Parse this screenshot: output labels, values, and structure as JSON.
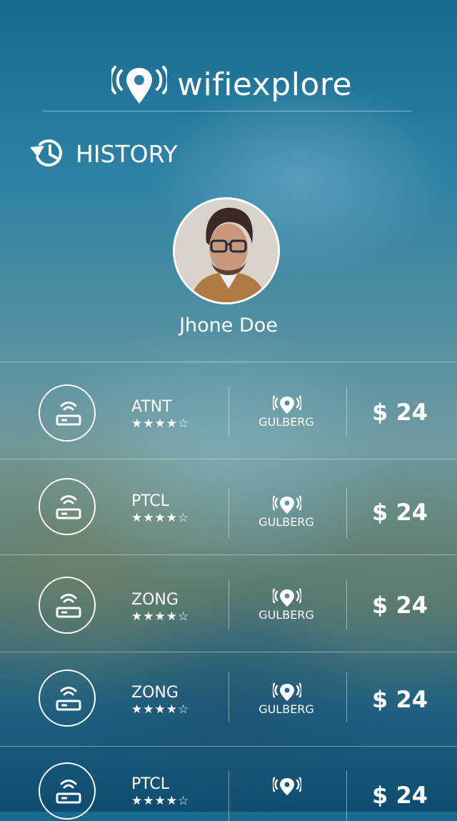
{
  "app": {
    "title": "wifiexplore",
    "logo_icon": "wifi-location-icon"
  },
  "section": {
    "title": "HISTORY",
    "icon": "history-icon"
  },
  "profile": {
    "name": "Jhone Doe",
    "avatar": "profile-photo"
  },
  "history_items": [
    {
      "network": "ATNT",
      "rating": 4,
      "stars": "★★★★☆",
      "location": "GULBERG",
      "price": "$ 24"
    },
    {
      "network": "PTCL",
      "rating": 4,
      "stars": "★★★★☆",
      "location": "GULBERG",
      "price": "$ 24"
    },
    {
      "network": "ZONG",
      "rating": 4,
      "stars": "★★★★☆",
      "location": "GULBERG",
      "price": "$ 24"
    },
    {
      "network": "ZONG",
      "rating": 4,
      "stars": "★★★★☆",
      "location": "GULBERG",
      "price": "$ 24"
    },
    {
      "network": "PTCL",
      "rating": 4,
      "stars": "★★★★☆",
      "location": "",
      "price": "$ 24"
    }
  ],
  "colors": {
    "accent": "#ffffff",
    "background_top": "#176a8e",
    "background_bottom": "#0f4d70"
  }
}
